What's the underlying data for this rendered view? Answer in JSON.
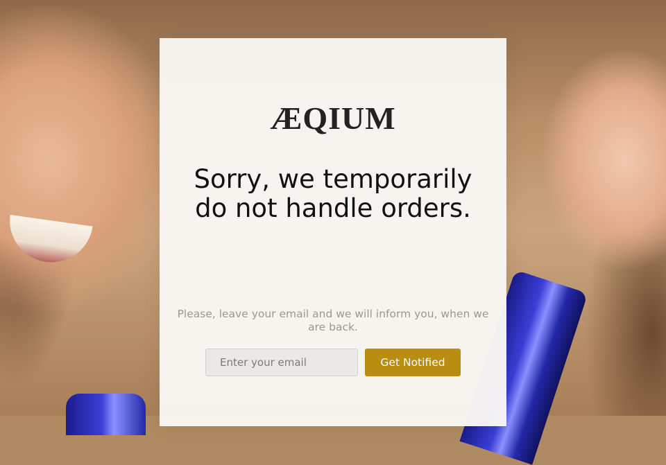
{
  "brand": {
    "logo_text": "ÆQIUM"
  },
  "message": {
    "headline_line1": "Sorry, we temporarily",
    "headline_line2": "do not handle orders.",
    "note_line1": "Please, leave your email and we will inform you, when we",
    "note_line2": "are back."
  },
  "form": {
    "email_placeholder": "Enter your email",
    "email_value": "",
    "submit_label": "Get Notified"
  },
  "colors": {
    "accent": "#b88d12",
    "card_background": "#f9f7f4",
    "headline_text": "#111111",
    "note_text": "#9a9794"
  }
}
